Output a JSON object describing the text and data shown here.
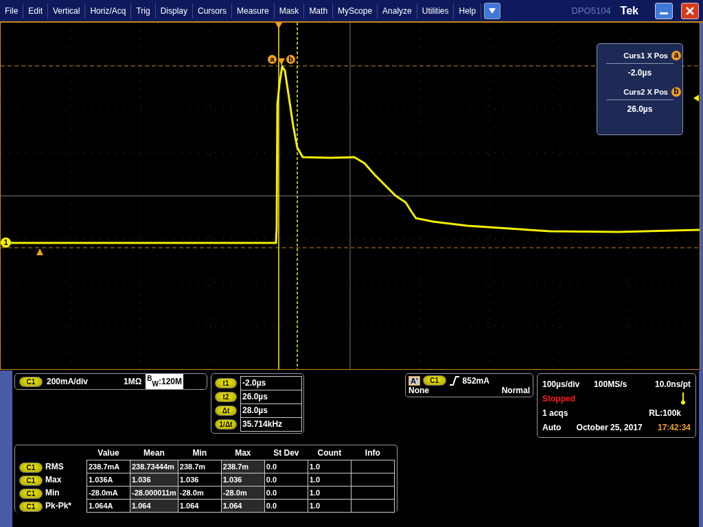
{
  "menu_bar": {
    "items": [
      "File",
      "Edit",
      "Vertical",
      "Horiz/Acq",
      "Trig",
      "Display",
      "Cursors",
      "Measure",
      "Mask",
      "Math",
      "MyScope",
      "Analyze",
      "Utilities",
      "Help"
    ],
    "model": "DPO5104",
    "brand": "Tek"
  },
  "graticule": {
    "channel_marker": "1",
    "cursor_a_label": "a",
    "cursor_b_label": "b"
  },
  "cursor_readout": [
    {
      "label": "Curs1 X Pos",
      "marker": "a",
      "value": "-2.0µs"
    },
    {
      "label": "Curs2 X Pos",
      "marker": "b",
      "value": "26.0µs"
    }
  ],
  "channel": {
    "badge": "C1",
    "scale": "200mA/div",
    "impedance": "1MΩ",
    "bandwidth": "$^{B}$$_{W}$:120M"
  },
  "cursors": [
    {
      "button": "t1",
      "value": "-2.0µs"
    },
    {
      "button": "t2",
      "value": "26.0µs"
    },
    {
      "button": "Δt",
      "value": "28.0µs"
    },
    {
      "button": "1/Δt",
      "value": "35.714kHz"
    }
  ],
  "trigger": {
    "tag": "A'",
    "badge": "C1",
    "level": "852mA",
    "coupling": "None",
    "mode": "Normal"
  },
  "acquisition": {
    "time_div": "100µs/div",
    "sample_rate": "100MS/s",
    "resolution": "10.0ns/pt",
    "state": "Stopped",
    "acqs": "1 acqs",
    "record_length": "RL:100k",
    "mode": "Auto",
    "date": "October 25, 2017",
    "time": "17:42:34"
  },
  "measurements": {
    "columns": [
      "Value",
      "Mean",
      "Min",
      "Max",
      "St Dev",
      "Count",
      "Info"
    ],
    "rows": [
      {
        "badge": "C1",
        "name": "RMS",
        "cells": [
          "238.7mA",
          "238.73444m",
          "238.7m",
          "238.7m",
          "0.0",
          "1.0"
        ]
      },
      {
        "badge": "C1",
        "name": "Max",
        "cells": [
          "1.036A",
          "1.036",
          "1.036",
          "1.036",
          "0.0",
          "1.0"
        ]
      },
      {
        "badge": "C1",
        "name": "Min",
        "cells": [
          "-28.0mA",
          "-28.000011m",
          "-28.0m",
          "-28.0m",
          "0.0",
          "1.0"
        ]
      },
      {
        "badge": "C1",
        "name": "Pk-Pk*",
        "cells": [
          "1.064A",
          "1.064",
          "1.064",
          "1.064",
          "0.0",
          "1.0"
        ]
      }
    ]
  }
}
